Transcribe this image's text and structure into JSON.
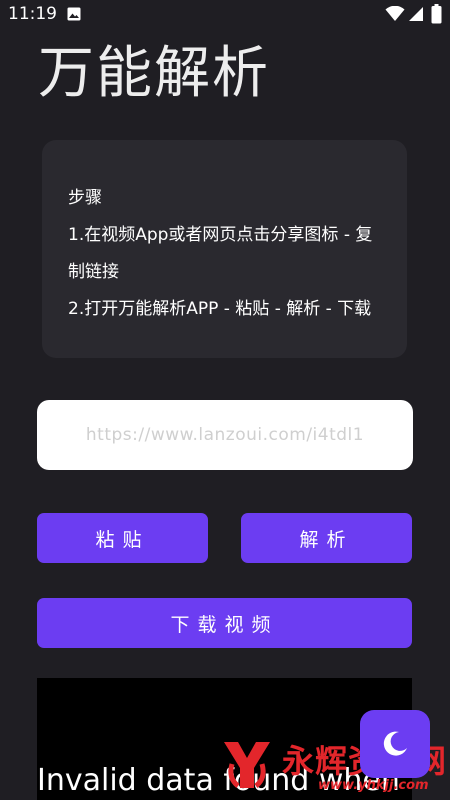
{
  "status_bar": {
    "time": "11:19",
    "icons": [
      "gallery-icon",
      "wifi-icon",
      "signal-icon",
      "battery-icon"
    ]
  },
  "app": {
    "title": "万能解析"
  },
  "steps": {
    "heading": "步骤",
    "step1": "1.在视频App或者网页点击分享图标 - 复制链接",
    "step2": "2.打开万能解析APP - 粘贴 - 解析 - 下载"
  },
  "url_input": {
    "value": "",
    "placeholder": "https://www.lanzoui.com/i4tdl1"
  },
  "buttons": {
    "paste_label": "粘贴",
    "parse_label": "解析",
    "download_label": "下载视频"
  },
  "video": {
    "error_text": "Invalid data found when"
  },
  "fab": {
    "icon": "moon-icon"
  },
  "watermark": {
    "text": "永辉资源网",
    "url": "www.yhkjj.com"
  },
  "colors": {
    "background": "#1f1e23",
    "card": "#2a292f",
    "accent": "#6c3df2",
    "watermark": "#e3262b"
  }
}
